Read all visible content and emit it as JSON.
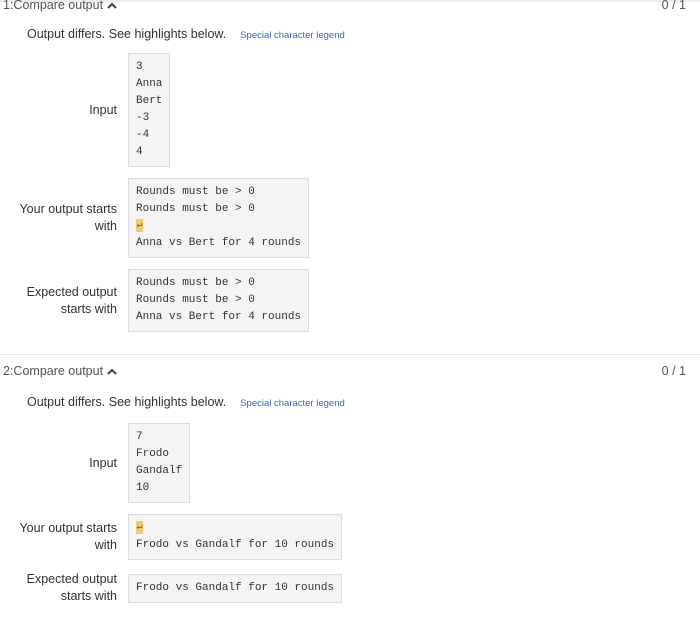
{
  "tests": [
    {
      "title": "1:Compare output",
      "score": "0 / 1",
      "diff_text": "Output differs. See highlights below.",
      "legend_link": "Special character legend",
      "input_label": "Input",
      "input_lines": [
        "3",
        "Anna",
        "Bert",
        "-3",
        "-4",
        "4"
      ],
      "your_output_label_1": "Your output starts",
      "your_output_label_2": "with",
      "your_output_lines": [
        "Rounds must be > 0",
        "Rounds must be > 0",
        "",
        "Anna vs Bert for 4 rounds"
      ],
      "newline_symbol": "↵",
      "expected_label_1": "Expected output",
      "expected_label_2": "starts with",
      "expected_lines": [
        "Rounds must be > 0",
        "Rounds must be > 0",
        "Anna vs Bert for 4 rounds"
      ]
    },
    {
      "title": "2:Compare output",
      "score": "0 / 1",
      "diff_text": "Output differs. See highlights below.",
      "legend_link": "Special character legend",
      "input_label": "Input",
      "input_lines": [
        "7",
        "Frodo",
        "Gandalf",
        "10"
      ],
      "your_output_label_1": "Your output starts",
      "your_output_label_2": "with",
      "your_output_lines": [
        "",
        "Frodo vs Gandalf for 10 rounds"
      ],
      "newline_symbol": "↵",
      "expected_label_1": "Expected output",
      "expected_label_2": "starts with",
      "expected_lines": [
        "Frodo vs Gandalf for 10 rounds"
      ]
    }
  ],
  "colors": {
    "highlight": "#f5c86a",
    "link": "#2d6bc4"
  },
  "icons": {
    "collapse": "chevron-up-icon"
  }
}
